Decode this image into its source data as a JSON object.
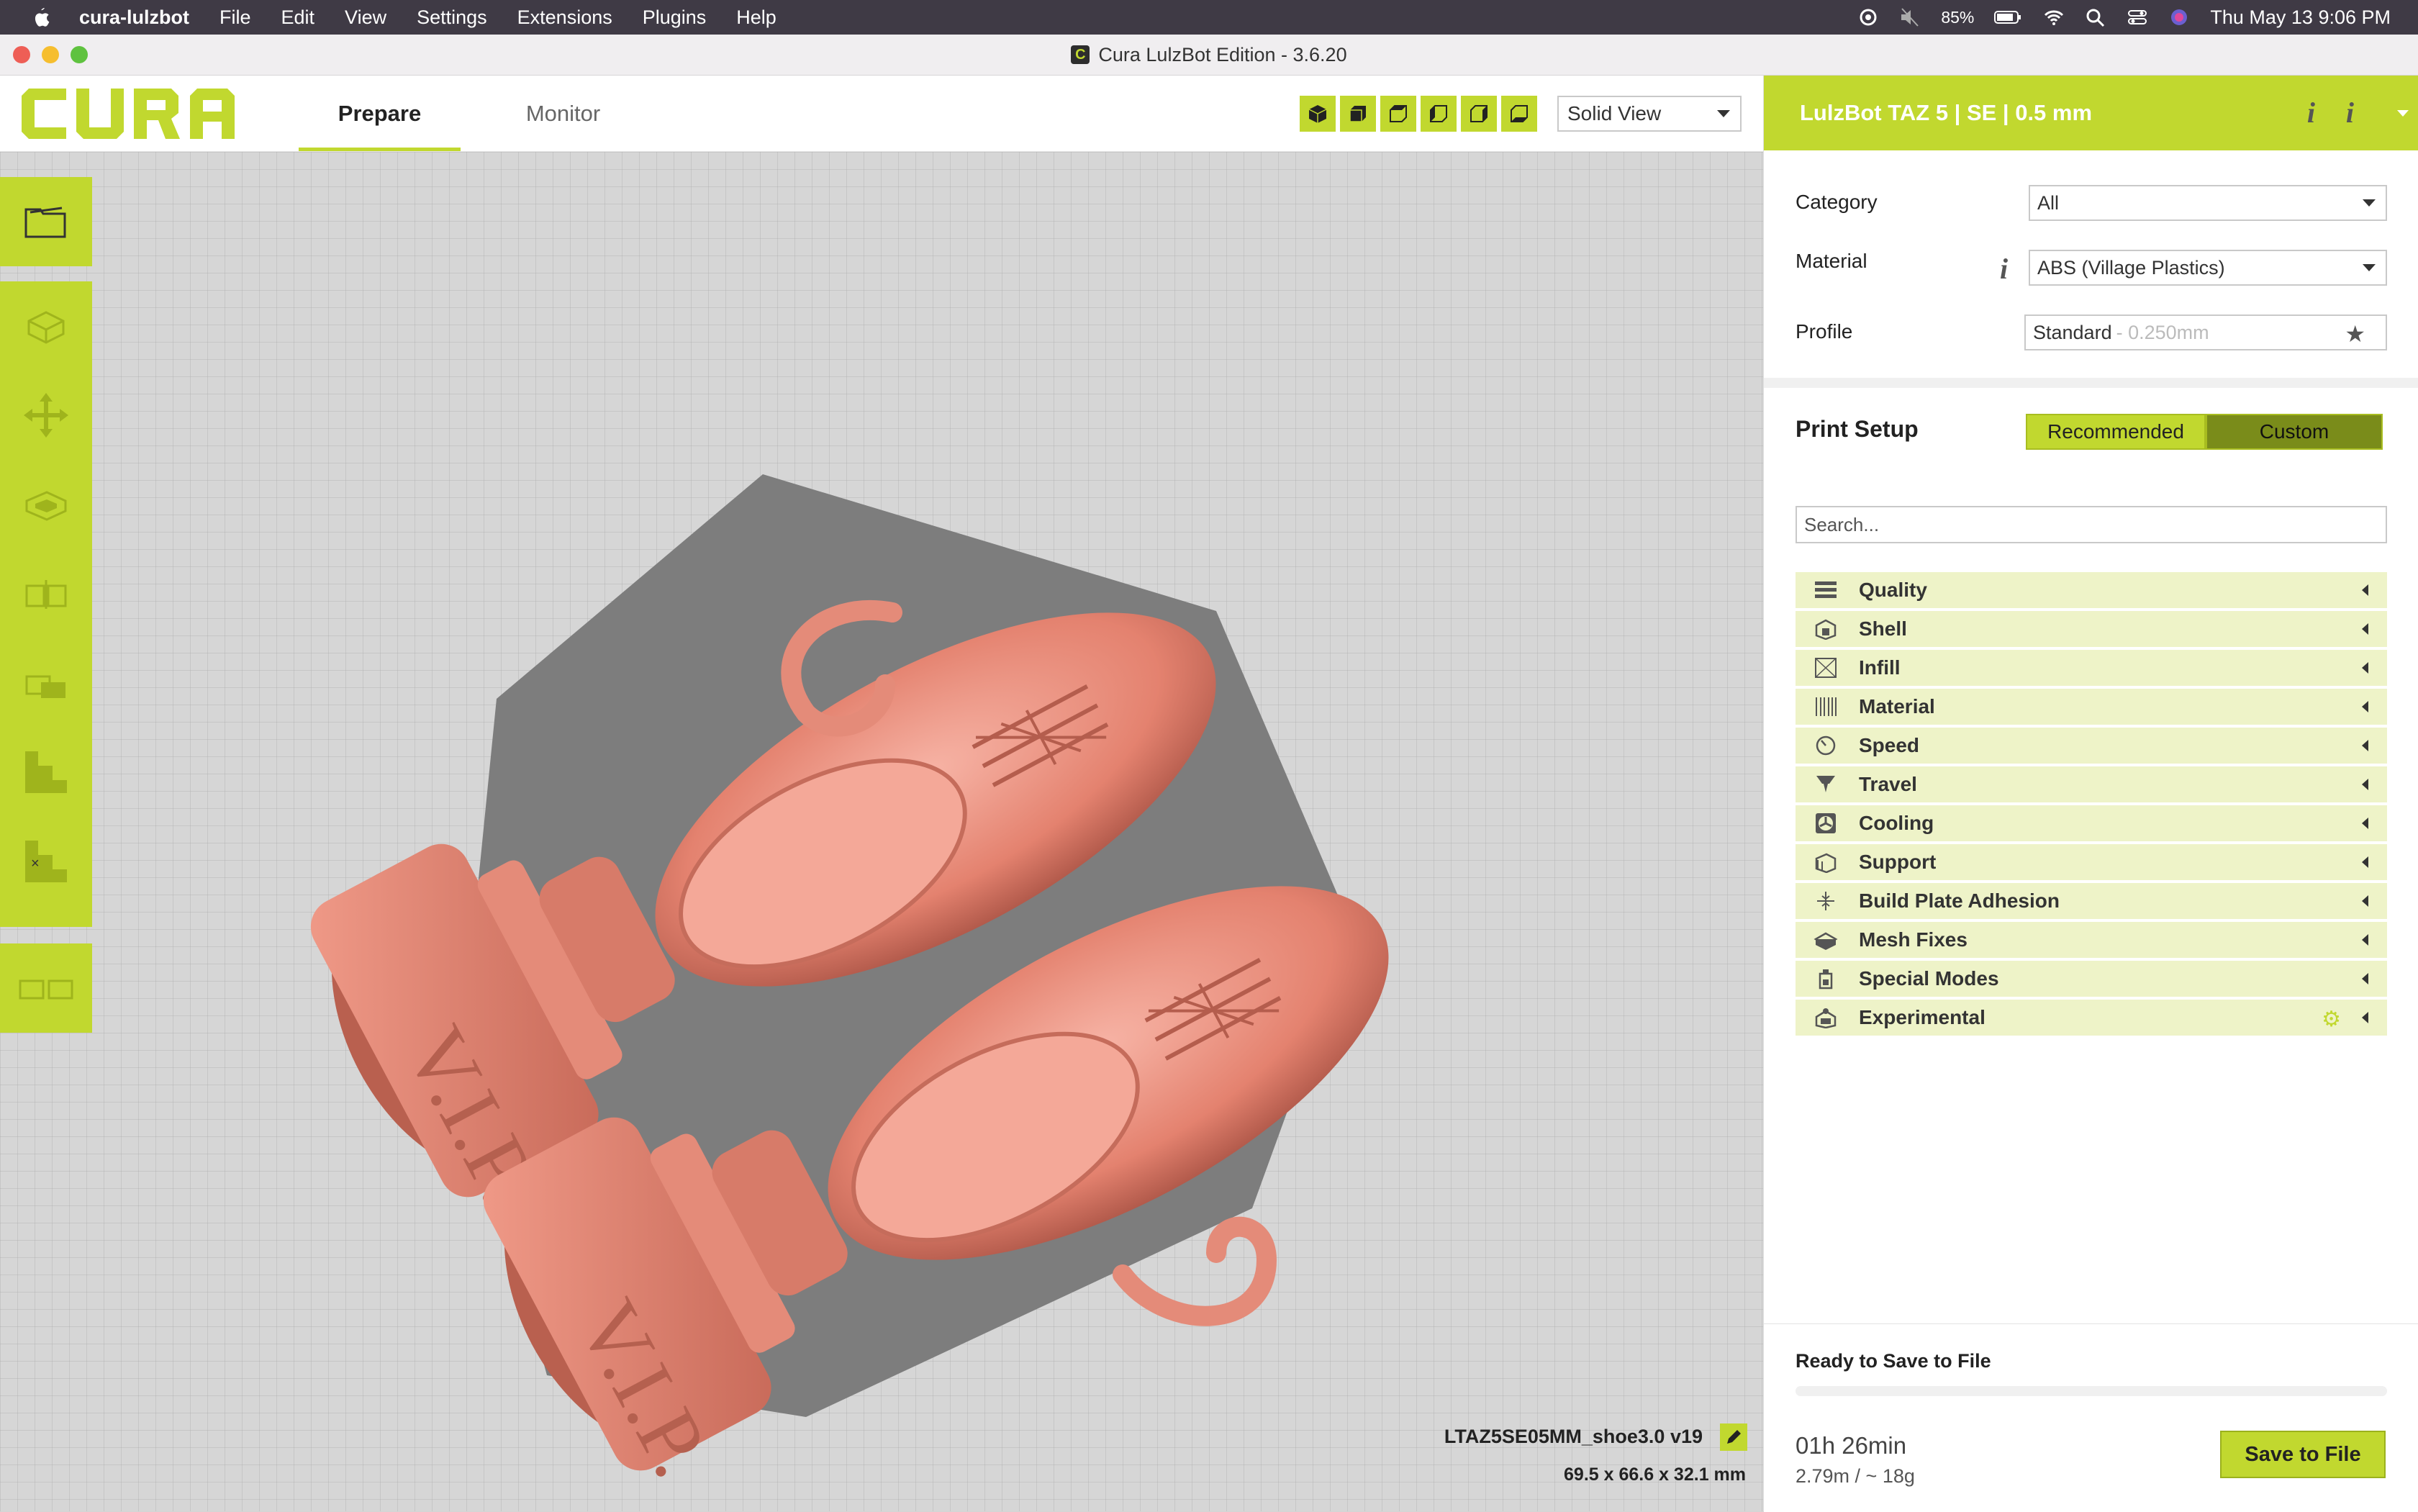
{
  "menubar": {
    "app_name": "cura-lulzbot",
    "items": [
      "File",
      "Edit",
      "View",
      "Settings",
      "Extensions",
      "Plugins",
      "Help"
    ],
    "battery": "85%",
    "datetime": "Thu May 13  9:06 PM"
  },
  "window": {
    "title": "Cura LulzBot Edition - 3.6.20"
  },
  "header": {
    "tabs": [
      "Prepare",
      "Monitor"
    ],
    "active_tab": "Prepare",
    "view_buttons": [
      "view-3d-icon",
      "view-front-icon",
      "view-top-icon",
      "view-left-icon",
      "view-right-icon",
      "view-bottom-icon"
    ],
    "view_mode": "Solid View"
  },
  "toolbar": {
    "open_file": "folder-icon",
    "tools": [
      "cube-outline-icon",
      "move-icon",
      "scale-icon",
      "mirror-icon",
      "per-model-settings-icon",
      "support-blocker-icon",
      "support-eraser-icon"
    ],
    "multiply": "multiply-icon"
  },
  "viewport": {
    "model_name": "LTAZ5SE05MM_shoe3.0 v19",
    "model_dims": "69.5 x 66.6 x 32.1 mm",
    "engraving": "V.I.P."
  },
  "sidebar": {
    "machine": "LulzBot TAZ 5 | SE | 0.5 mm",
    "category_label": "Category",
    "category_value": "All",
    "material_label": "Material",
    "material_value": "ABS (Village Plastics)",
    "profile_label": "Profile",
    "profile_value": "Standard",
    "profile_suffix": "- 0.250mm",
    "print_setup_label": "Print Setup",
    "mode_recommended": "Recommended",
    "mode_custom": "Custom",
    "search_placeholder": "Search...",
    "categories": [
      {
        "label": "Quality",
        "icon": "quality-icon"
      },
      {
        "label": "Shell",
        "icon": "shell-icon"
      },
      {
        "label": "Infill",
        "icon": "infill-icon"
      },
      {
        "label": "Material",
        "icon": "material-icon"
      },
      {
        "label": "Speed",
        "icon": "speed-icon"
      },
      {
        "label": "Travel",
        "icon": "travel-icon"
      },
      {
        "label": "Cooling",
        "icon": "cooling-icon"
      },
      {
        "label": "Support",
        "icon": "support-icon"
      },
      {
        "label": "Build Plate Adhesion",
        "icon": "adhesion-icon"
      },
      {
        "label": "Mesh Fixes",
        "icon": "mesh-fixes-icon"
      },
      {
        "label": "Special Modes",
        "icon": "special-modes-icon"
      },
      {
        "label": "Experimental",
        "icon": "experimental-icon"
      }
    ]
  },
  "output": {
    "status": "Ready to Save to File",
    "progress": 0,
    "print_time": "01h 26min",
    "material_usage": "2.79m / ~ 18g",
    "save_label": "Save to File"
  },
  "colors": {
    "accent": "#c1d82f",
    "accent_dark": "#7a8c1a",
    "model": "#e8897a",
    "shadow": "#7d7d7d"
  }
}
